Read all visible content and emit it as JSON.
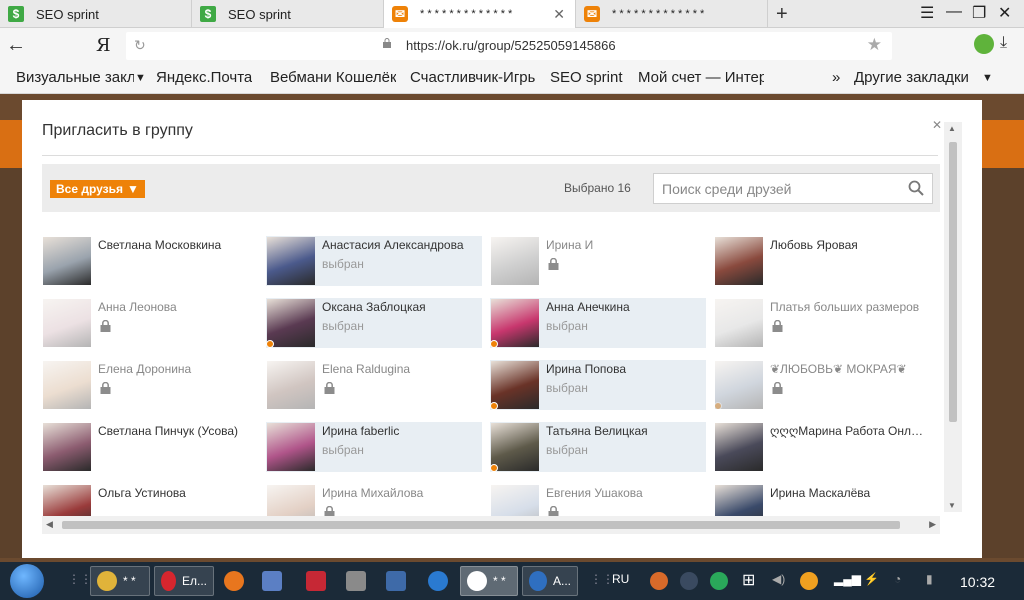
{
  "browser": {
    "tabs": [
      {
        "title": "SEO sprint",
        "favicon": "seo-sprint-icon"
      },
      {
        "title": "SEO sprint",
        "favicon": "seo-sprint-icon"
      },
      {
        "title": "* * * * * * * * * * * * *",
        "favicon": "odnoklassniki-icon"
      },
      {
        "title": "* * * * * * * * * * * * *",
        "favicon": "odnoklassniki-icon"
      }
    ],
    "new_tab_label": "+",
    "ya_logo": "Я",
    "url": "https://ok.ru/group/52525059145866",
    "bookmarks": [
      "Визуальные закладки",
      "Яндекс.Почта",
      "Вебмани Кошелёк",
      "Счастливчик-Игры",
      "SEO sprint",
      "Мой счет — Интернет",
      "Другие закладки"
    ]
  },
  "modal": {
    "title": "Пригласить в группу",
    "filter_label": "Все друзья",
    "selected_text": "Выбрано 16",
    "search_placeholder": "Поиск среди друзей",
    "selected_status": "выбран",
    "friends": [
      {
        "name": "Светлана Московкина",
        "selected": false,
        "locked": false,
        "online": false,
        "color": "#9aa3ad"
      },
      {
        "name": "Анастасия Александрова",
        "selected": true,
        "locked": false,
        "online": false,
        "color": "#4b5a8c"
      },
      {
        "name": "Ирина И",
        "selected": false,
        "locked": true,
        "online": false,
        "color": "#777777"
      },
      {
        "name": "Любовь Яровая",
        "selected": false,
        "locked": false,
        "online": false,
        "color": "#8a4a3e"
      },
      {
        "name": "Анна Леонова",
        "selected": false,
        "locked": true,
        "online": false,
        "color": "#c9a9b0"
      },
      {
        "name": "Оксана Заблоцкая",
        "selected": true,
        "locked": false,
        "online": true,
        "color": "#5a3a52"
      },
      {
        "name": "Анна Анечкина",
        "selected": true,
        "locked": false,
        "online": true,
        "color": "#c8376e"
      },
      {
        "name": "Платья больших размеров",
        "selected": false,
        "locked": true,
        "online": false,
        "color": "#bdbdbd"
      },
      {
        "name": "Елена Доронина",
        "selected": false,
        "locked": true,
        "online": false,
        "color": "#c9a07a"
      },
      {
        "name": "Elena Raldugina",
        "selected": false,
        "locked": true,
        "online": false,
        "color": "#7a5a4e"
      },
      {
        "name": "Ирина Попова",
        "selected": true,
        "locked": false,
        "online": true,
        "color": "#6a3328"
      },
      {
        "name": "❦ЛЮБОВЬ❦ МОКРАЯ❦",
        "selected": false,
        "locked": true,
        "online": true,
        "color": "#7a8aa0"
      },
      {
        "name": "Светлана Пинчук (Усова)",
        "selected": false,
        "locked": false,
        "online": false,
        "color": "#8c5c70"
      },
      {
        "name": "Ирина faberlic",
        "selected": true,
        "locked": false,
        "online": false,
        "color": "#b0558a"
      },
      {
        "name": "Татьяна Велицкая",
        "selected": true,
        "locked": false,
        "online": true,
        "color": "#5e5a4a"
      },
      {
        "name": "ღღღМарина Работа Онлайн",
        "selected": false,
        "locked": false,
        "online": false,
        "color": "#4a4a5a"
      },
      {
        "name": "Ольга Устинова",
        "selected": false,
        "locked": false,
        "online": false,
        "color": "#9a3b3b"
      },
      {
        "name": "Ирина Михайлова",
        "selected": false,
        "locked": true,
        "online": false,
        "color": "#b07a5a"
      },
      {
        "name": "Евгения Ушакова",
        "selected": false,
        "locked": true,
        "online": false,
        "color": "#8aa0c0"
      },
      {
        "name": "Ирина Маскалёва",
        "selected": false,
        "locked": false,
        "online": false,
        "color": "#3a4a6a"
      }
    ]
  },
  "taskbar": {
    "apps": [
      "* *",
      "Ел...",
      "* *",
      "А..."
    ],
    "lang": "RU",
    "clock": "10:32"
  }
}
